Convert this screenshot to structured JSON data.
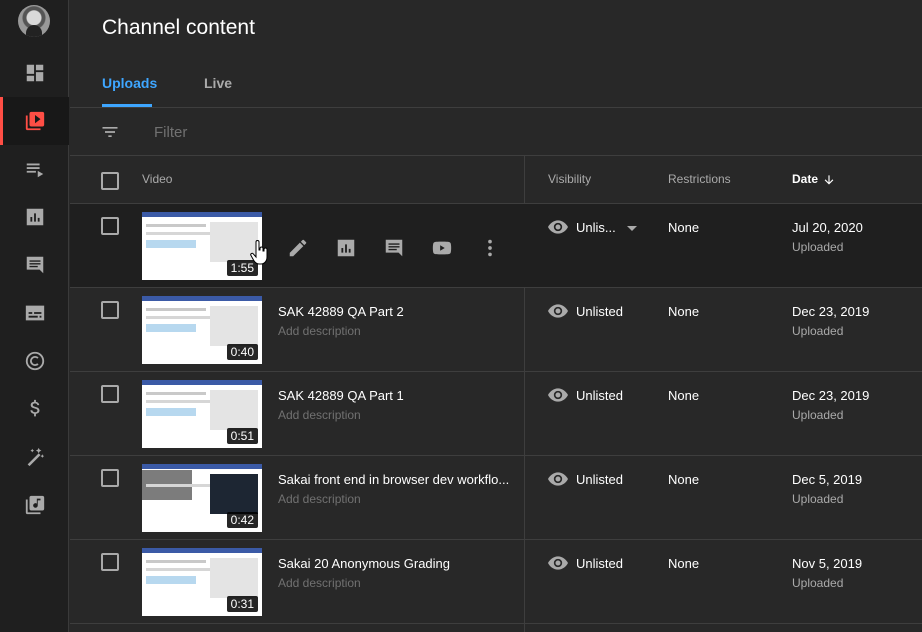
{
  "page": {
    "title": "Channel content"
  },
  "tabs": [
    {
      "label": "Uploads"
    },
    {
      "label": "Live"
    }
  ],
  "filter": {
    "placeholder": "Filter"
  },
  "columns": {
    "video": "Video",
    "visibility": "Visibility",
    "restrictions": "Restrictions",
    "date": "Date"
  },
  "rows": [
    {
      "title": "",
      "description": "",
      "duration": "1:55",
      "visibility": "Unlis...",
      "restrictions": "None",
      "date": "Jul 20, 2020",
      "status": "Uploaded"
    },
    {
      "title": "SAK 42889 QA Part 2",
      "description": "Add description",
      "duration": "0:40",
      "visibility": "Unlisted",
      "restrictions": "None",
      "date": "Dec 23, 2019",
      "status": "Uploaded"
    },
    {
      "title": "SAK 42889 QA Part 1",
      "description": "Add description",
      "duration": "0:51",
      "visibility": "Unlisted",
      "restrictions": "None",
      "date": "Dec 23, 2019",
      "status": "Uploaded"
    },
    {
      "title": "Sakai front end in browser dev workflo...",
      "description": "Add description",
      "duration": "0:42",
      "visibility": "Unlisted",
      "restrictions": "None",
      "date": "Dec 5, 2019",
      "status": "Uploaded"
    },
    {
      "title": "Sakai 20 Anonymous Grading",
      "description": "Add description",
      "duration": "0:31",
      "visibility": "Unlisted",
      "restrictions": "None",
      "date": "Nov 5, 2019",
      "status": "Uploaded"
    }
  ],
  "sidebar": {
    "items": [
      "dashboard-icon",
      "content-icon",
      "playlists-icon",
      "analytics-icon",
      "comments-icon",
      "subtitles-icon",
      "copyright-icon",
      "monetization-icon",
      "customization-icon",
      "audio-library-icon"
    ]
  },
  "colors": {
    "accent": "#3ea6ff",
    "brand": "#ff4e45",
    "background": "#282828",
    "sidebar": "#1f1f1f"
  }
}
